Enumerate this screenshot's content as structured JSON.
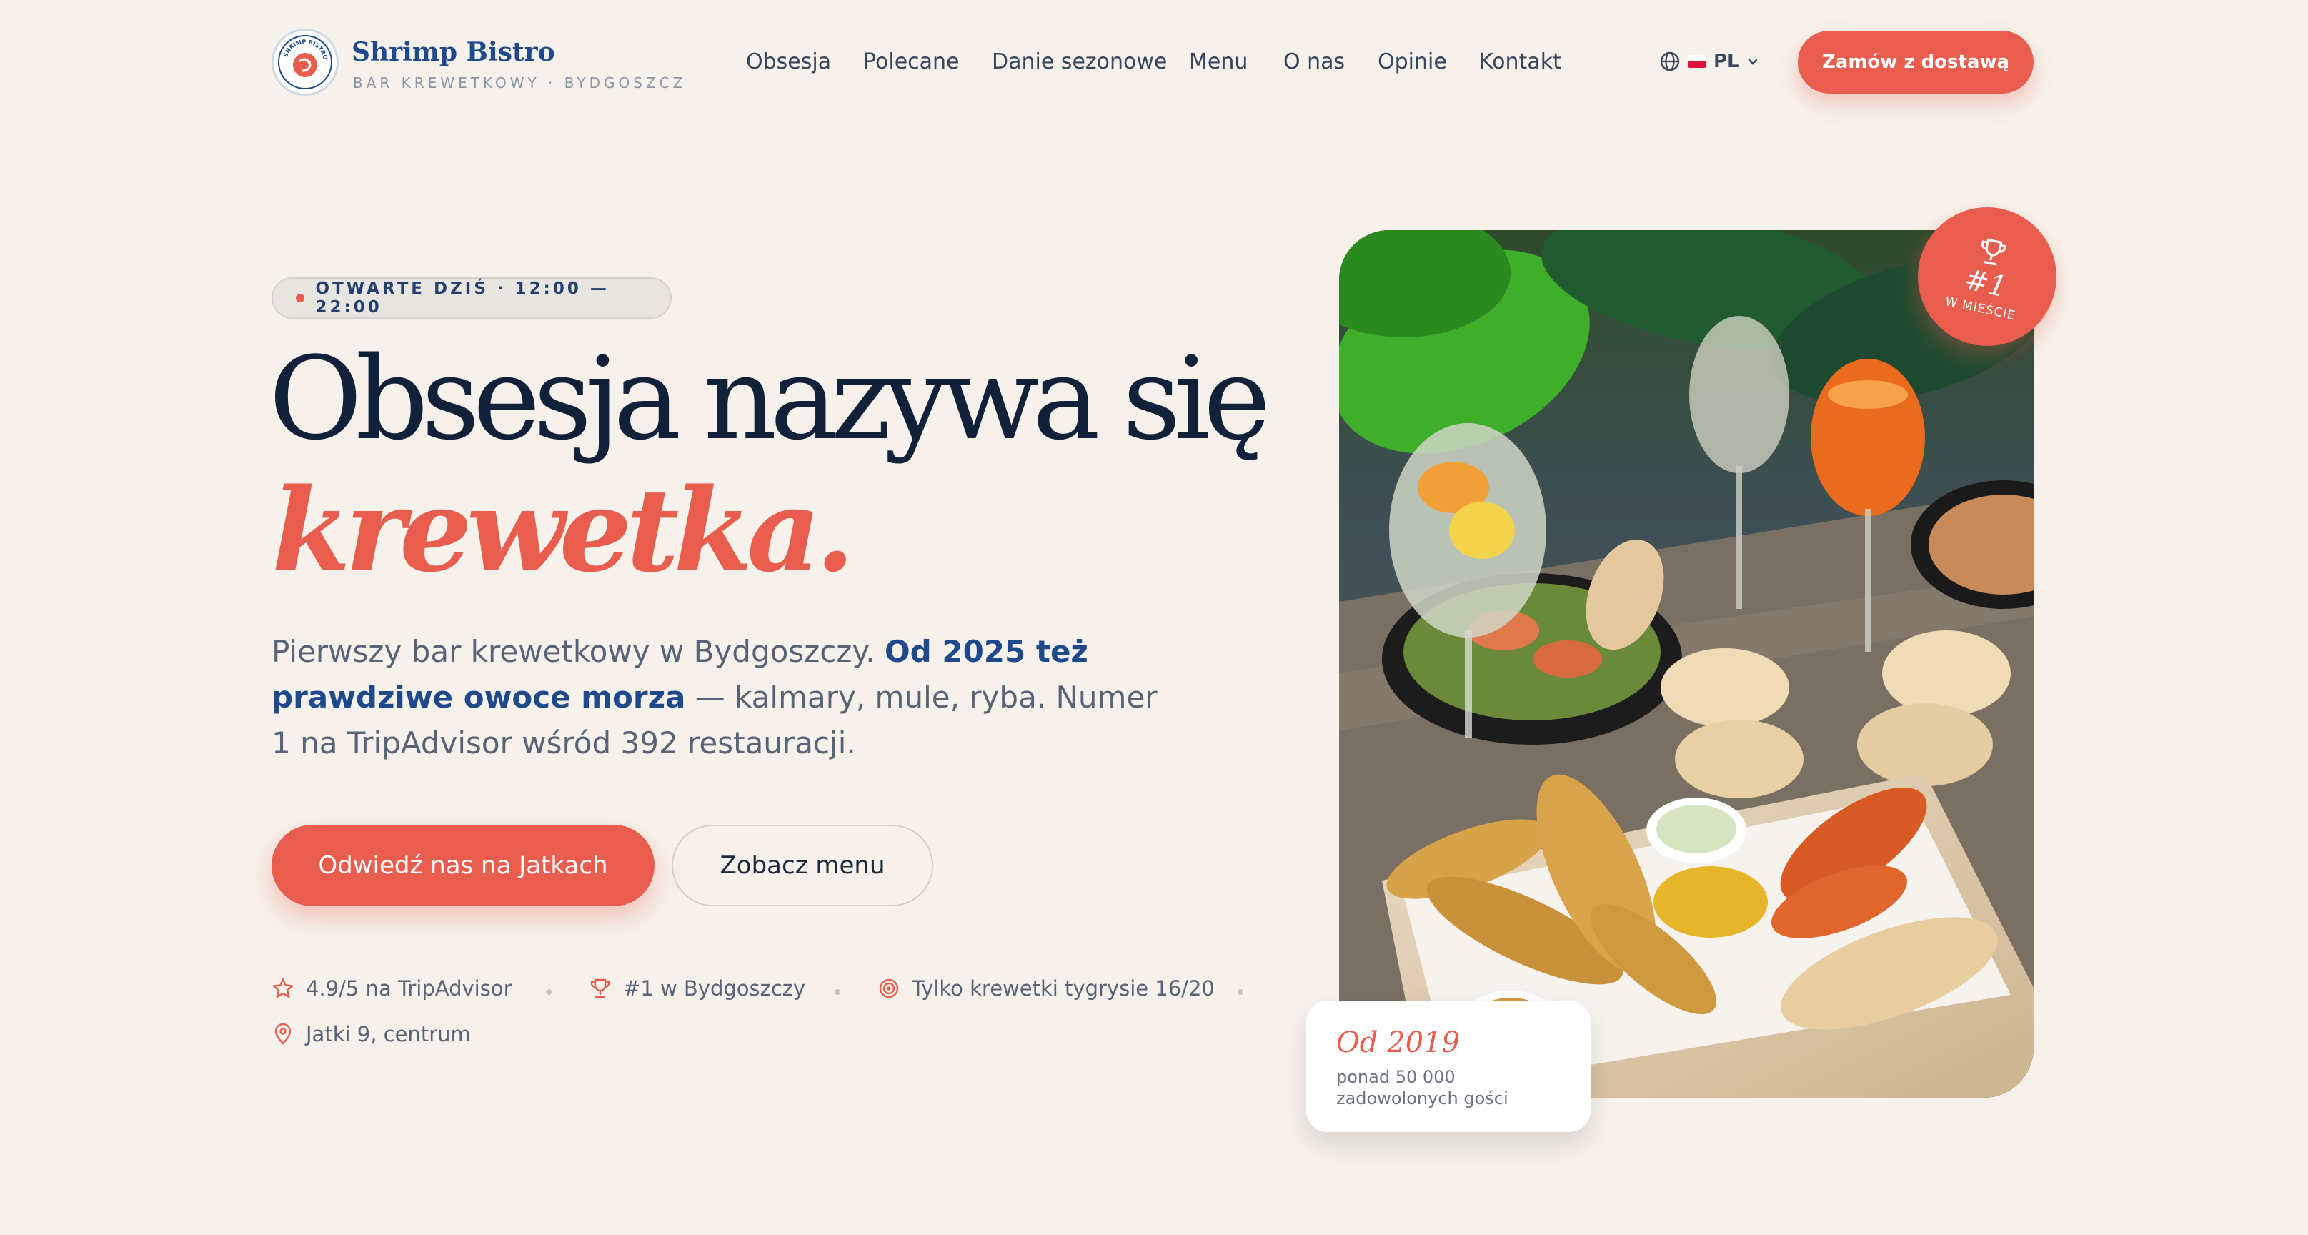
{
  "brand": {
    "name": "Shrimp Bistro",
    "tagline": "BAR KREWETKOWY · BYDGOSZCZ",
    "logo_icon": "shrimp-logo",
    "logo_ring_text": "SHRIMP BISTRO"
  },
  "nav": {
    "items": [
      {
        "label": "Obsesja"
      },
      {
        "label": "Polecane"
      },
      {
        "label": "Danie sezonowe"
      },
      {
        "label": "Menu"
      },
      {
        "label": "O nas"
      },
      {
        "label": "Opinie"
      },
      {
        "label": "Kontakt"
      }
    ],
    "language": {
      "icon": "globe-icon",
      "code": "PL",
      "flag": "poland-flag",
      "chevron": "chevron-down-icon"
    },
    "cta_label": "Zamów z dostawą"
  },
  "hero": {
    "status": "OTWARTE DZIŚ · 12:00 — 22:00",
    "headline_1": "Obsesja nazywa się",
    "headline_2": "krewetka.",
    "lead_1": "Pierwszy bar krewetkowy w Bydgoszczy. ",
    "lead_strong": "Od 2025 też prawdziwe owoce morza",
    "lead_2": " — kalmary, mule, ryba. Numer 1 na TripAdvisor wśród 392 restauracji.",
    "primary_cta": "Odwiedź nas na Jatkach",
    "secondary_cta": "Zobacz menu",
    "stats": [
      {
        "icon": "star-icon",
        "label": "4.9/5 na TripAdvisor"
      },
      {
        "icon": "trophy-icon",
        "label": "#1 w Bydgoszczy"
      },
      {
        "icon": "spiral-icon",
        "label": "Tylko krewetki tygrysie 16/20"
      },
      {
        "icon": "map-pin-icon",
        "label": "Jatki 9, centrum"
      }
    ]
  },
  "photo": {
    "subject": "food-platter-photo",
    "badge": {
      "icon": "trophy-icon",
      "number": "#1",
      "text": "W MIEŚCIE"
    },
    "since_card": {
      "title": "Od 2019",
      "subtitle": "ponad 50 000 zadowolonych gości"
    }
  },
  "colors": {
    "accent": "#e85d4e",
    "navy": "#12213a",
    "brand_blue": "#1e4a8c",
    "background": "#f6f1ea"
  }
}
